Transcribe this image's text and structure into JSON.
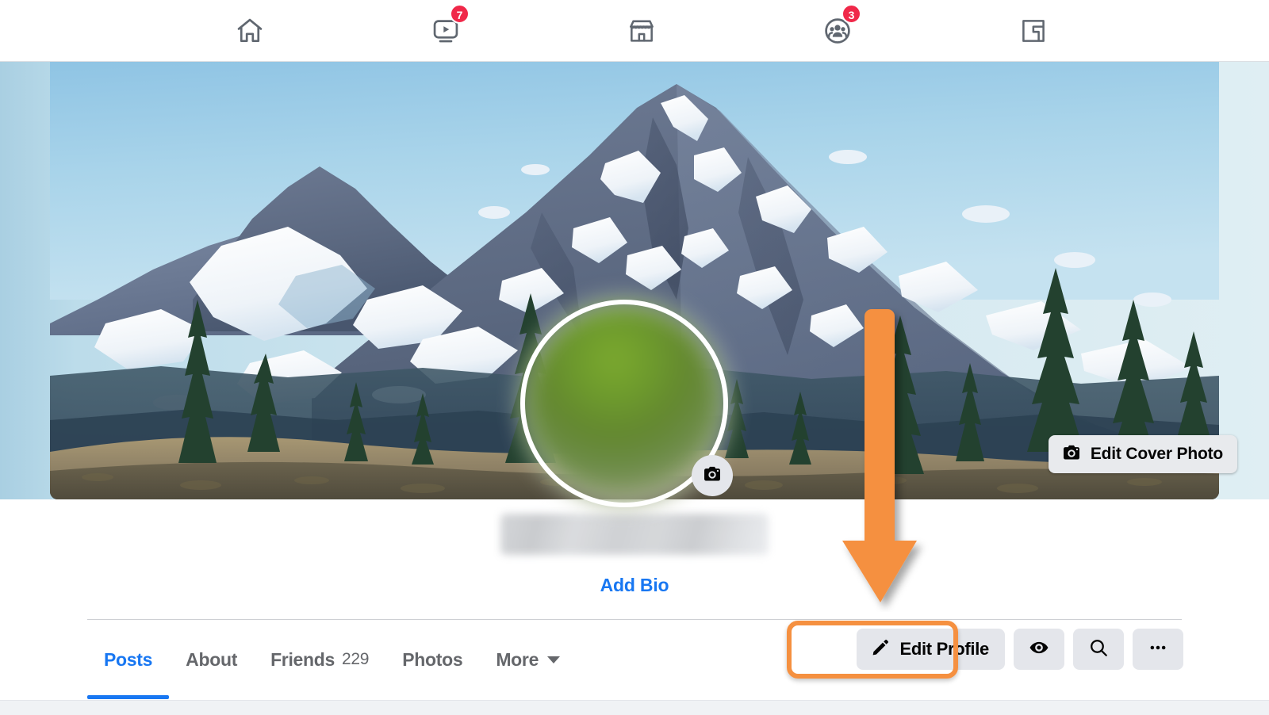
{
  "topnav": {
    "items": [
      {
        "name": "home",
        "icon": "home-icon",
        "label": "Home",
        "badge": ""
      },
      {
        "name": "video",
        "icon": "video-icon",
        "label": "Video",
        "badge": "7"
      },
      {
        "name": "marketplace",
        "icon": "marketplace-icon",
        "label": "Marketplace",
        "badge": ""
      },
      {
        "name": "groups",
        "icon": "groups-icon",
        "label": "Groups",
        "badge": "3"
      },
      {
        "name": "gaming",
        "icon": "gaming-icon",
        "label": "Gaming",
        "badge": ""
      }
    ],
    "badge_video": "7",
    "badge_groups": "3"
  },
  "cover": {
    "edit_cover_label": "Edit Cover Photo",
    "camera_icon": "camera-icon",
    "description": "Snow-capped mountain landscape with conifer trees and open meadow"
  },
  "profile": {
    "avatar_alt": "Profile photo (blurred for privacy)",
    "avatar_camera_icon": "camera-icon",
    "name_redacted": true,
    "add_bio_label": "Add Bio"
  },
  "tabs": [
    {
      "label": "Posts",
      "count": "",
      "active": true
    },
    {
      "label": "About",
      "count": "",
      "active": false
    },
    {
      "label": "Friends",
      "count": "229",
      "active": false
    },
    {
      "label": "Photos",
      "count": "",
      "active": false
    },
    {
      "label": "More",
      "count": "",
      "active": false,
      "has_caret": true
    }
  ],
  "actions": {
    "edit_profile_label": "Edit Profile",
    "edit_profile_icon": "pencil-icon",
    "view_as_icon": "eye-icon",
    "search_icon": "search-icon",
    "more_icon": "ellipsis-icon"
  },
  "annotation": {
    "type": "arrow",
    "direction": "down",
    "points_to": "Edit Profile",
    "color": "#F59040",
    "highlight_color": "#F59040"
  },
  "colors": {
    "accent_blue": "#1877f2",
    "badge_red": "#f02849",
    "button_gray": "#e4e6eb",
    "text_primary": "#050505",
    "text_secondary": "#65676b",
    "annotation_orange": "#f59040",
    "page_bg": "#f0f2f5"
  }
}
